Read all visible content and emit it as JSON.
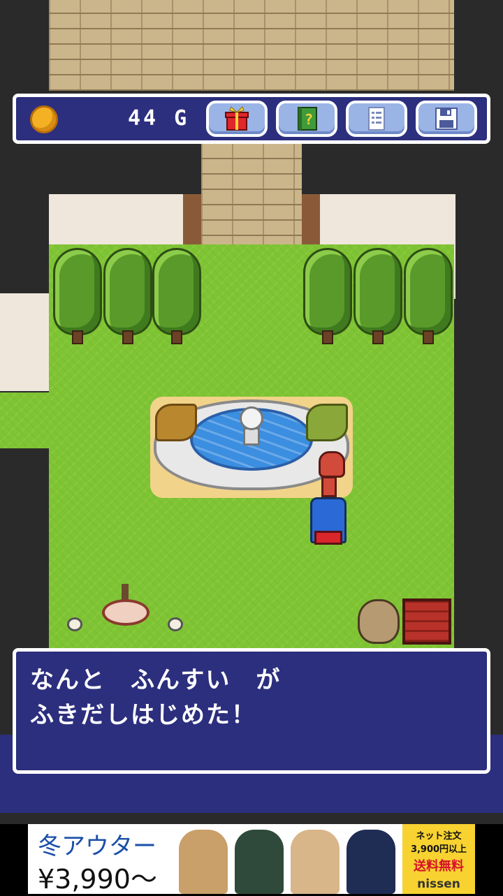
{
  "hud": {
    "gold": "44 G",
    "buttons": [
      "gift-icon",
      "help-book-icon",
      "menu-list-icon",
      "save-disk-icon"
    ]
  },
  "dialog": {
    "line1": "なんと　ふんすい　が",
    "line2": "ふきだしはじめた！"
  },
  "ad": {
    "title": "冬アウター",
    "price": "¥3,990〜",
    "side_line1": "ネット注文",
    "side_line2": "3,900円以上",
    "side_line3": "送料無料",
    "brand": "nissen"
  },
  "colors": {
    "panel": "#2c2f7d",
    "grass": "#7fc437",
    "brick": "#cbb58a"
  }
}
